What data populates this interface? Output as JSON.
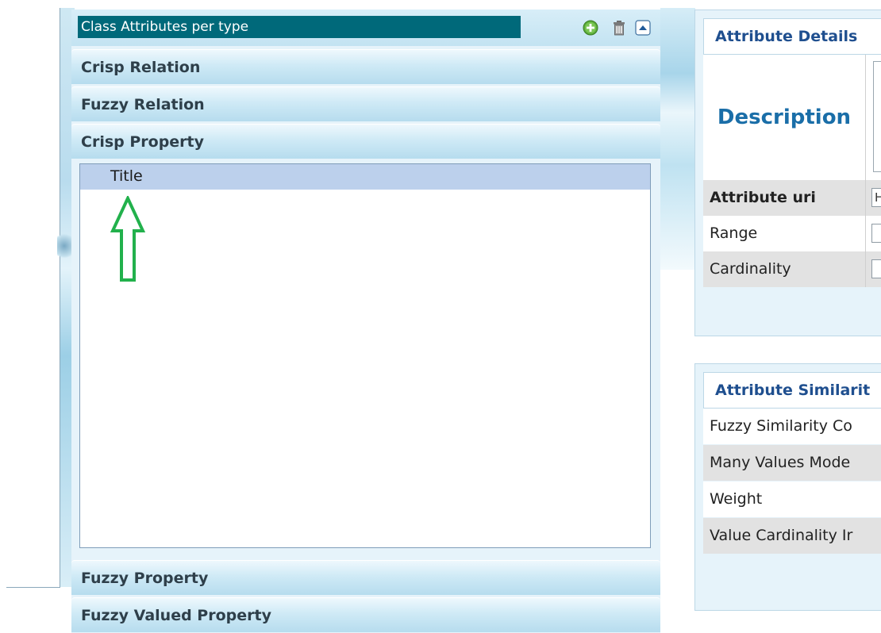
{
  "left_panel": {
    "header_title": "Class Attributes per type",
    "header_icons": [
      "add-icon",
      "trash-icon",
      "collapse-icon"
    ],
    "sections": {
      "crisp_relation": "Crisp Relation",
      "fuzzy_relation": "Fuzzy Relation",
      "crisp_property": "Crisp Property",
      "fuzzy_property": "Fuzzy Property",
      "fuzzy_valued_property": "Fuzzy Valued Property"
    },
    "crisp_property_items": [
      "Title"
    ],
    "annotation": "green-up-arrow-icon"
  },
  "attribute_details": {
    "header": "Attribute Details",
    "description_label": "Description",
    "attribute_uri_label": "Attribute uri",
    "attribute_uri_value": "H",
    "range_label": "Range",
    "cardinality_label": "Cardinality"
  },
  "attribute_similarity": {
    "header": "Attribute Similarit",
    "rows": [
      "Fuzzy Similarity Co",
      "Many Values Mode",
      "Weight",
      "Value Cardinality Ir"
    ]
  },
  "colors": {
    "header_teal": "#00697a",
    "panel_header_blue": "#1f4f8f",
    "description_blue": "#1a6ea8",
    "selected_row": "#bcd0ec",
    "arrow_green": "#22b14c"
  }
}
